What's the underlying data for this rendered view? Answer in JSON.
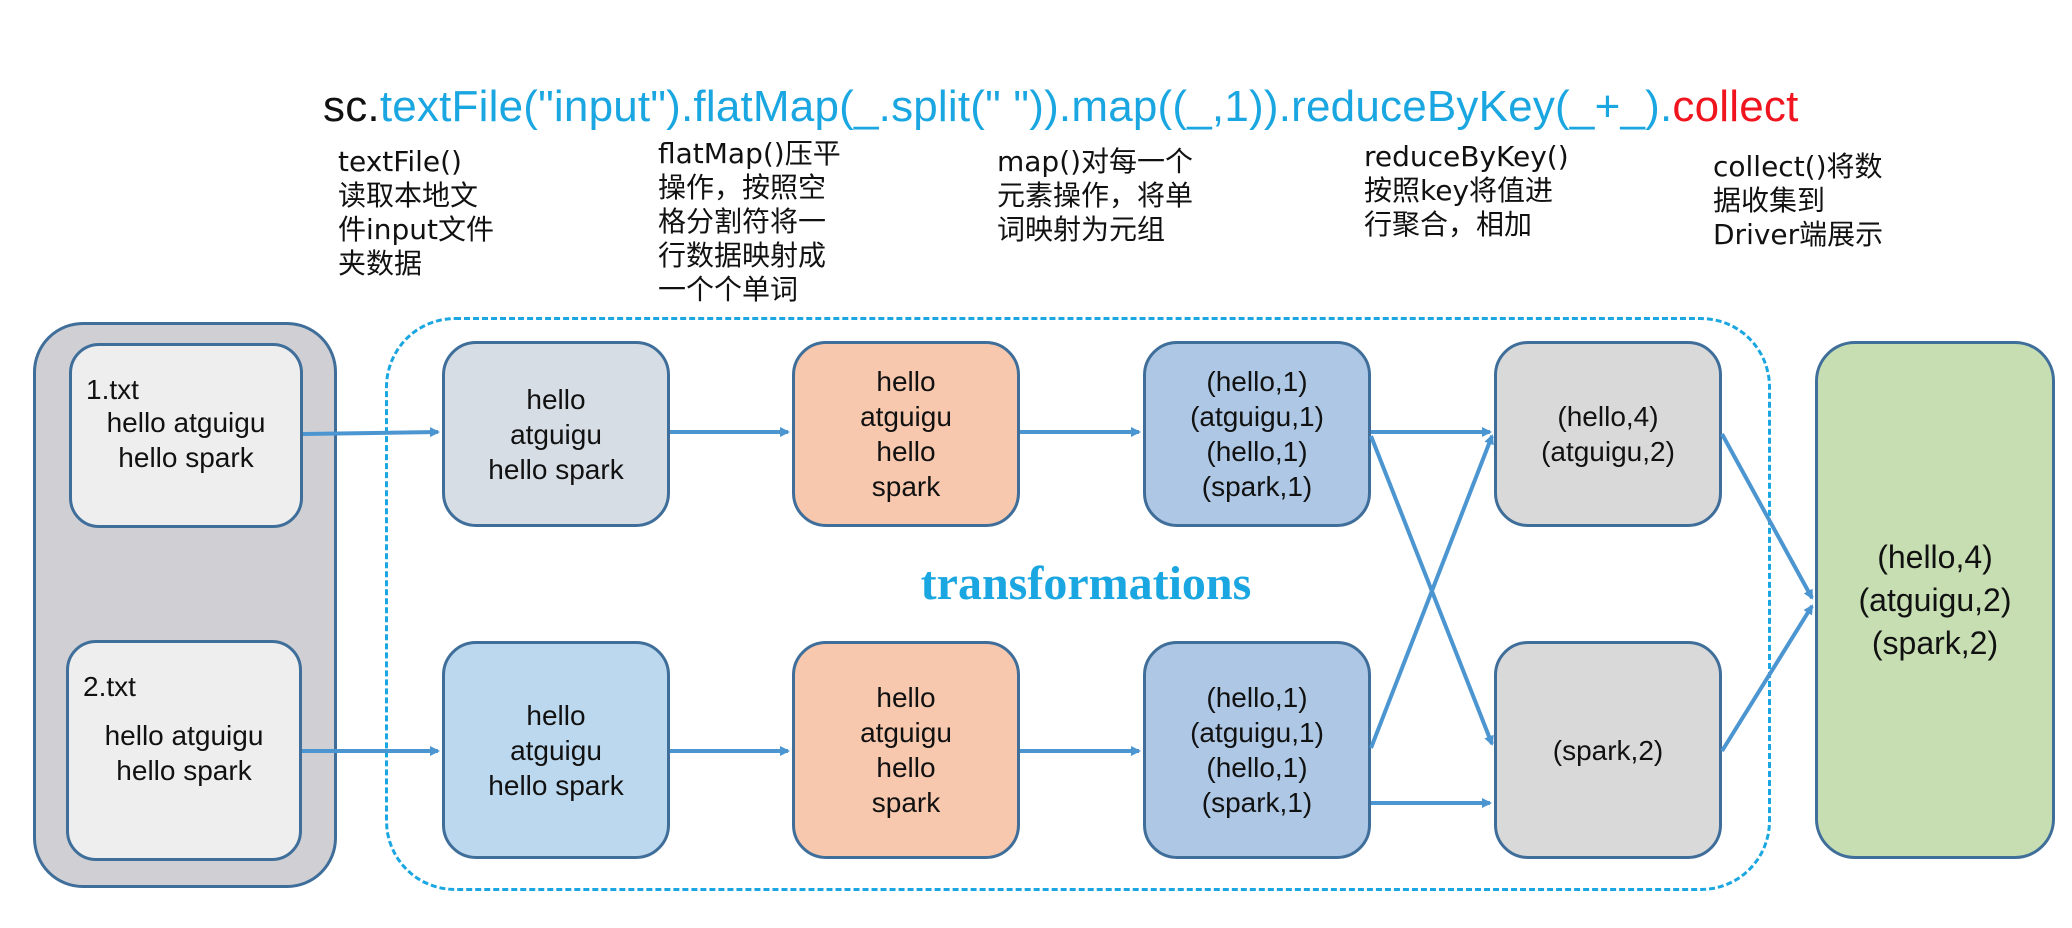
{
  "code_line": {
    "prefix": "sc.",
    "transformations": "textFile(\"input\").flatMap(_.split(\" \")).map((_,1)).reduceByKey(_+_).",
    "action": "collect"
  },
  "annotations": {
    "textfile": "textFile()\n读取本地文\n件input文件\n夹数据",
    "flatmap": "flatMap()压平\n操作，按照空\n格分割符将一\n行数据映射成\n一个个单词",
    "map": "map()对每一个\n元素操作，将单\n词映射为元组",
    "reducebykey": "reduceByKey()\n按照key将值进\n行聚合，相加",
    "collect": "collect()将数\n据收集到\nDriver端展示"
  },
  "files": [
    {
      "name": "1.txt",
      "content": "hello atguigu\nhello spark"
    },
    {
      "name": "2.txt",
      "content": "hello atguigu\nhello spark"
    }
  ],
  "textfile_boxes": [
    "hello\natguigu\nhello spark",
    "hello\natguigu\nhello spark"
  ],
  "flatmap_boxes": [
    "hello\natguigu\nhello\nspark",
    "hello\natguigu\nhello\nspark"
  ],
  "map_boxes": [
    "(hello,1)\n(atguigu,1)\n(hello,1)\n(spark,1)",
    "(hello,1)\n(atguigu,1)\n(hello,1)\n(spark,1)"
  ],
  "reduce_boxes": [
    "(hello,4)\n(atguigu,2)",
    "(spark,2)"
  ],
  "collect_box": "(hello,4)\n(atguigu,2)\n(spark,2)",
  "transformations_label": "transformations",
  "colors": {
    "ops_text": "#1aa6e0",
    "action_text": "#f0141e",
    "arrow": "#4b95d1",
    "box_border": "#3f6e9a"
  }
}
